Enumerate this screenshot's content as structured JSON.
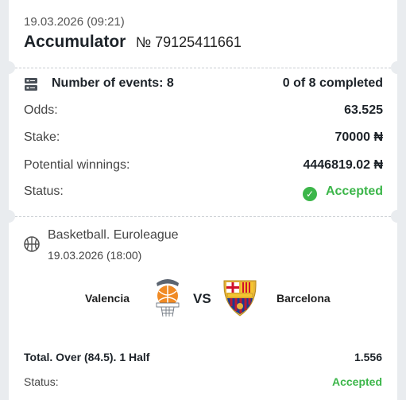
{
  "ticket": {
    "datetime": "19.03.2026 (09:21)",
    "type": "Accumulator",
    "number": "№ 79125411661"
  },
  "summary": {
    "events_label": "Number of events: 8",
    "events_progress": "0 of 8 completed",
    "odds_label": "Odds:",
    "odds_value": "63.525",
    "stake_label": "Stake:",
    "stake_value": "70000 ₦",
    "winnings_label": "Potential winnings:",
    "winnings_value": "4446819.02 ₦",
    "status_label": "Status:",
    "status_value": "Accepted"
  },
  "event": {
    "league": "Basketball. Euroleague",
    "datetime": "19.03.2026 (18:00)",
    "home_team": "Valencia",
    "vs": "VS",
    "away_team": "Barcelona",
    "bet": "Total. Over (84.5). 1 Half",
    "bet_odds": "1.556",
    "status_label": "Status:",
    "status_value": "Accepted"
  },
  "colors": {
    "accent_green": "#3cb64a",
    "text_dark": "#1d2329",
    "background": "#e9ecef"
  },
  "icons": [
    "events-icon",
    "check-icon",
    "basketball-icon",
    "valencia-logo",
    "barcelona-logo"
  ]
}
